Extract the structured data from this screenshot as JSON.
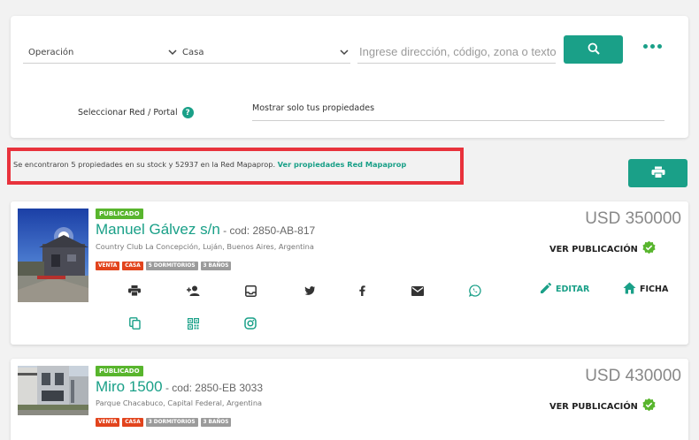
{
  "search": {
    "operation_label": "Operación",
    "type_label": "Casa",
    "placeholder": "Ingrese dirección, código, zona o texto",
    "network_label": "Seleccionar Red / Portal",
    "help_glyph": "?",
    "own_only_label": "Mostrar solo tus propiedades"
  },
  "results": {
    "summary": "Se encontraron 5 propiedades en su stock y 52937 en la Red Mapaprop.",
    "link": "Ver propiedades Red Mapaprop"
  },
  "labels": {
    "ver_publicacion": "VER PUBLICACIÓN",
    "editar": "EDITAR",
    "ficha": "FICHA"
  },
  "properties": [
    {
      "status": "PUBLICADO",
      "title": "Manuel Gálvez s/n",
      "code": " - cod: 2850-AB-817",
      "address": "Country Club La Concepción, Luján, Buenos Aires, Argentina",
      "tags": [
        "VENTA",
        "CASA",
        "5 DORMITORIOS",
        "3 BAÑOS"
      ],
      "price": "USD 350000"
    },
    {
      "status": "PUBLICADO",
      "title": "Miro 1500",
      "code": " - cod: 2850-EB 3033",
      "address": "Parque Chacabuco, Capital Federal, Argentina",
      "tags": [
        "VENTA",
        "CASA",
        "3 DORMITORIOS",
        "3 BAÑOS"
      ],
      "price": "USD 430000"
    }
  ],
  "colors": {
    "accent": "#1aa088",
    "published": "#58b52d",
    "operation_tag": "#e2441d",
    "feature_tag": "#9b9b9b",
    "highlight_box": "#e8323c"
  }
}
